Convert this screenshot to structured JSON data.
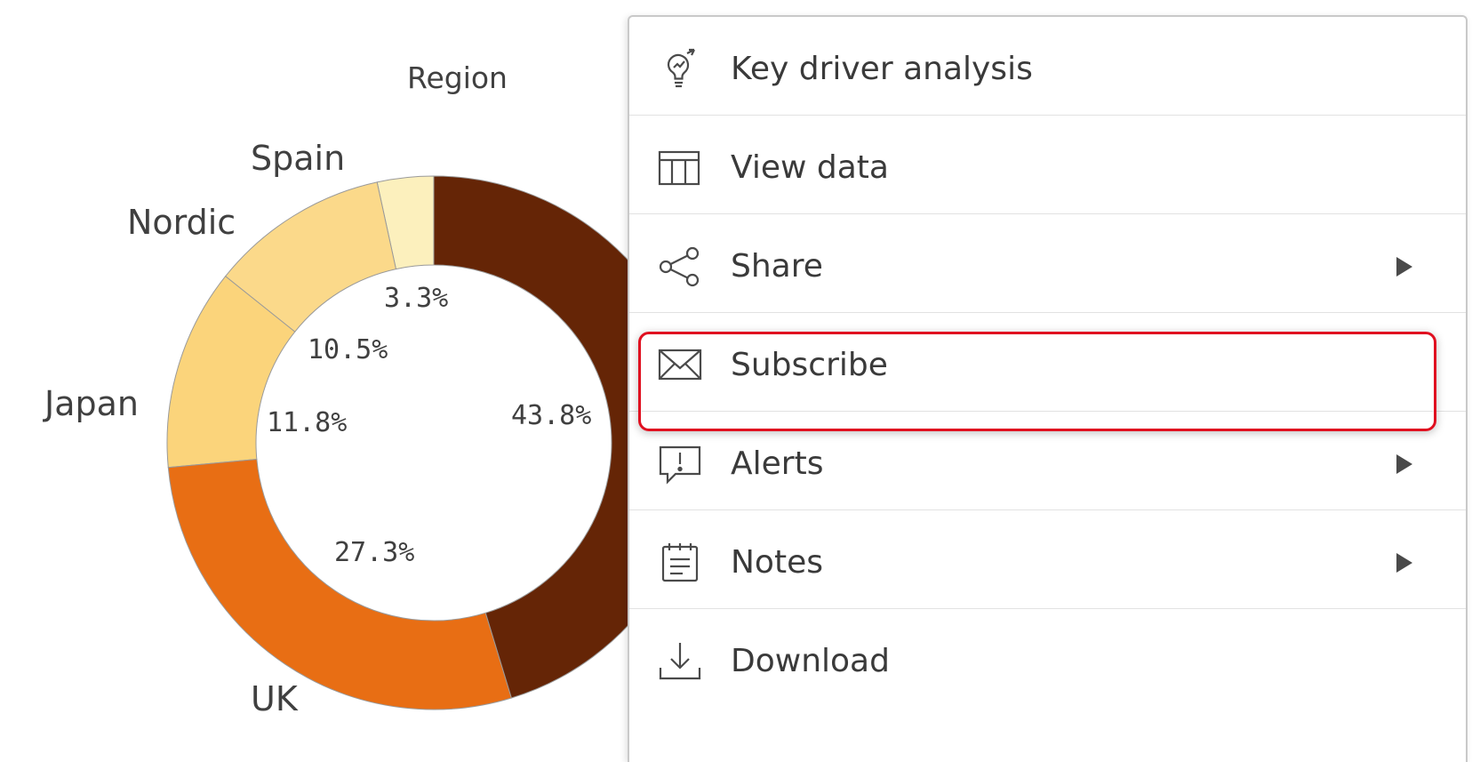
{
  "chart_data": {
    "type": "pie",
    "title": "Region",
    "categories": [
      "Spain",
      "Nordic",
      "Japan",
      "UK",
      ""
    ],
    "values": [
      3.3,
      10.5,
      11.8,
      27.3,
      43.8
    ],
    "data_labels": [
      "3.3%",
      "10.5%",
      "11.8%",
      "27.3%",
      "43.8%"
    ],
    "colors": [
      "#fcf0bd",
      "#fbd98a",
      "#fbd47b",
      "#e86e14",
      "#652506"
    ],
    "hole": "donut"
  },
  "region_labels": {
    "spain": "Spain",
    "nordic": "Nordic",
    "japan": "Japan",
    "uk": "UK"
  },
  "menu": {
    "items": [
      {
        "label": "Key driver analysis",
        "icon": "lightbulb-icon",
        "has_submenu": false
      },
      {
        "label": "View data",
        "icon": "table-icon",
        "has_submenu": false
      },
      {
        "label": "Share",
        "icon": "share-icon",
        "has_submenu": true
      },
      {
        "label": "Subscribe",
        "icon": "envelope-icon",
        "has_submenu": false,
        "highlighted": true
      },
      {
        "label": "Alerts",
        "icon": "alert-icon",
        "has_submenu": true
      },
      {
        "label": "Notes",
        "icon": "notes-icon",
        "has_submenu": true
      },
      {
        "label": "Download",
        "icon": "download-icon",
        "has_submenu": false
      }
    ],
    "highlight_color": "#e01020"
  }
}
